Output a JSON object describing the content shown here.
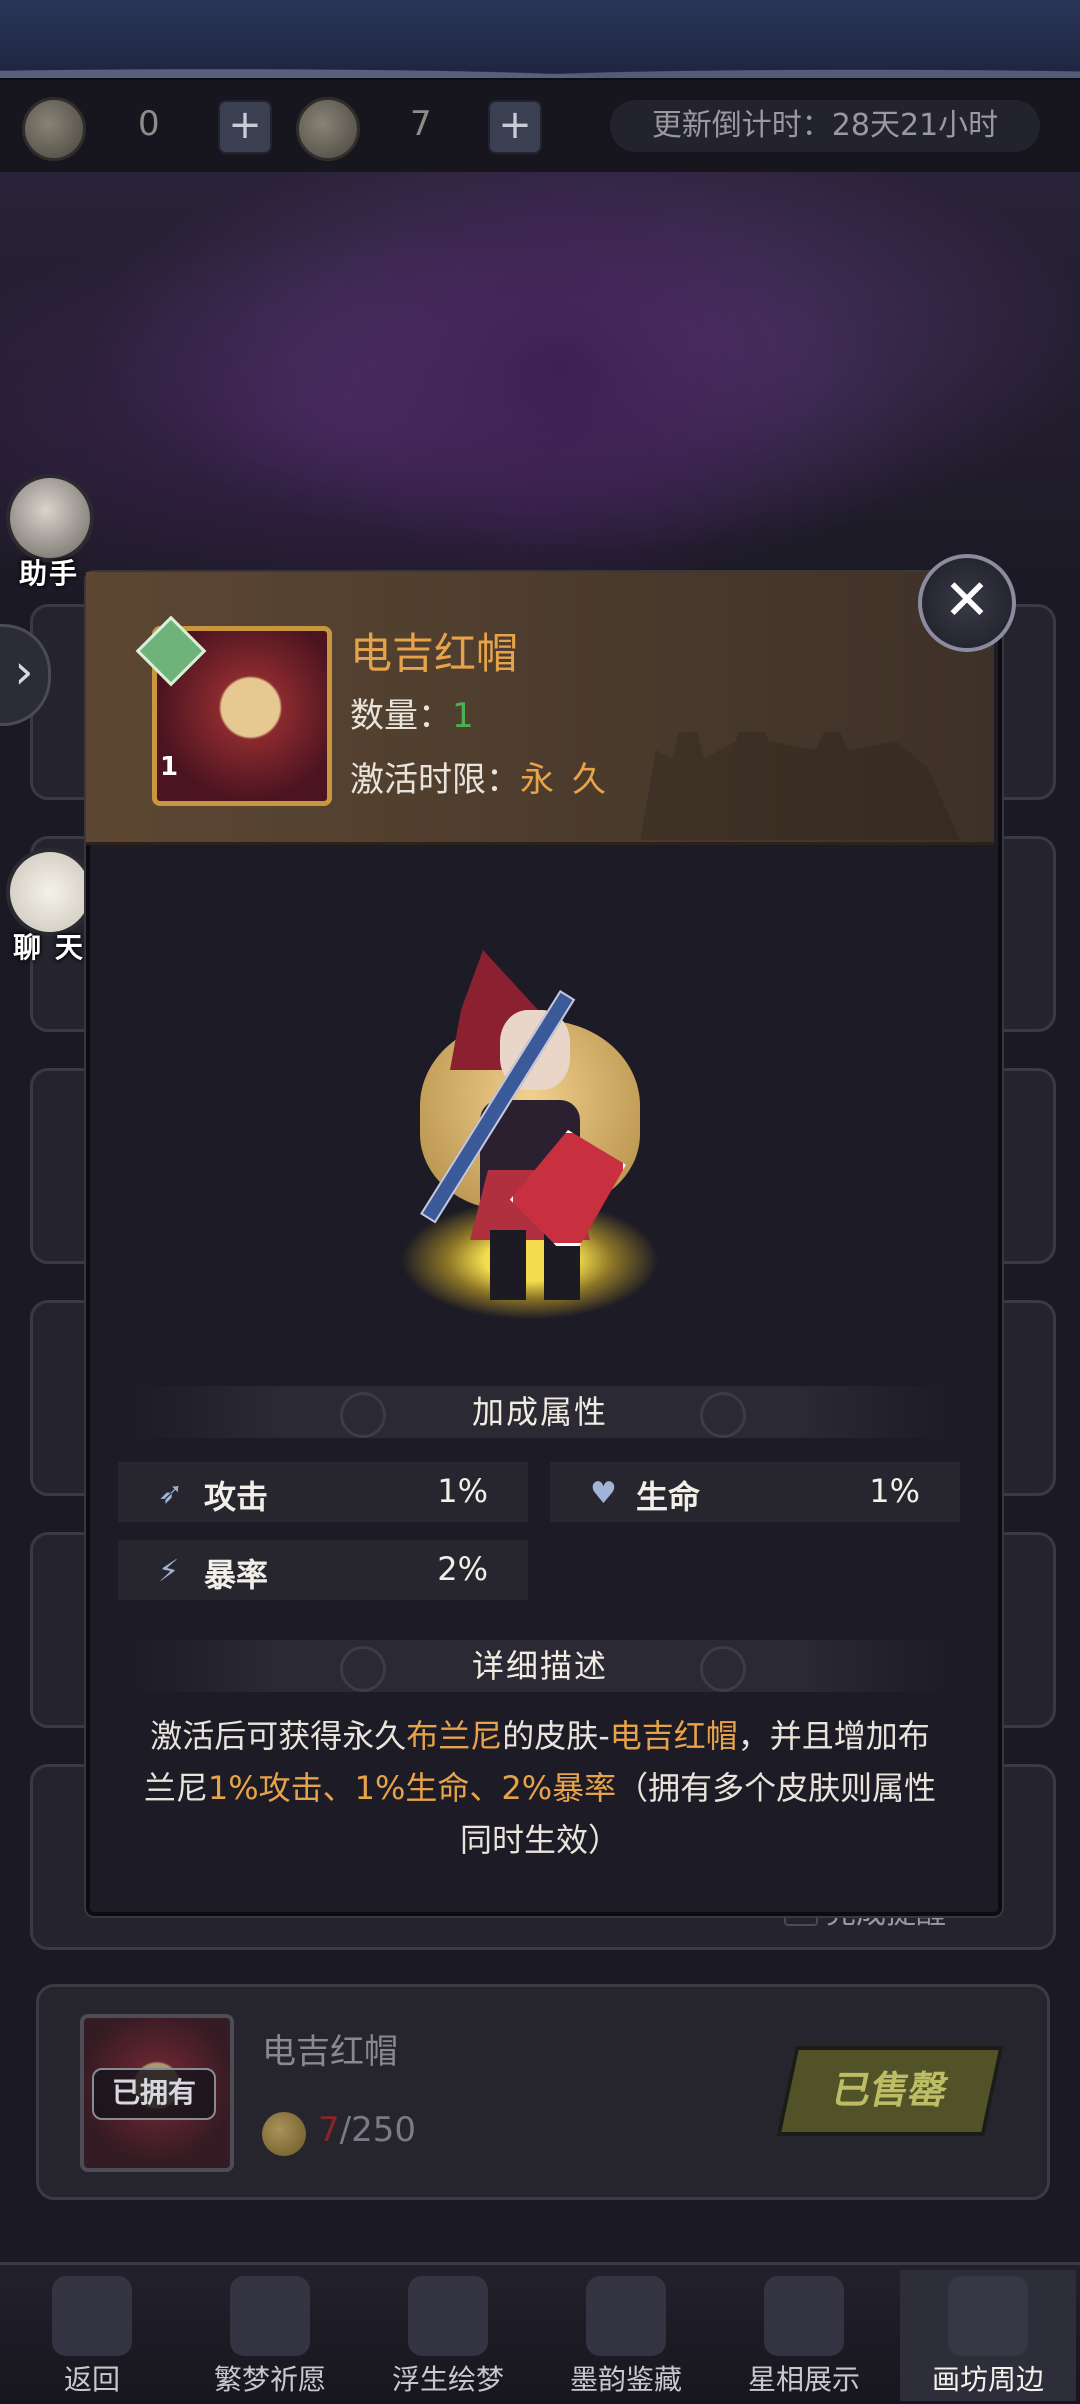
{
  "resources": [
    {
      "icon": "coin-icon",
      "value": "0"
    },
    {
      "icon": "gold-coin-icon",
      "value": "7"
    }
  ],
  "countdown": "更新倒计时：28天21小时",
  "help_label": "?",
  "side": {
    "assistant_label": "助手",
    "chat_label": "聊 天",
    "expand_icon": "›"
  },
  "modal": {
    "skin_name": "电吉红帽",
    "quantity_label": "数量：",
    "quantity_value": "1",
    "limit_label": "激活时限：",
    "limit_value": "永久",
    "portrait_count": "1",
    "close_icon": "✕",
    "bonus_title": "加成属性",
    "stats": [
      {
        "icon": "attack-icon",
        "label": "攻击",
        "value": "1%"
      },
      {
        "icon": "heart-icon",
        "label": "生命",
        "value": "1%"
      },
      {
        "icon": "crit-icon",
        "label": "暴率",
        "value": "2%"
      }
    ],
    "detail_title": "详细描述",
    "desc": {
      "p1": "激活后可获得永久",
      "h1": "布兰尼",
      "p2": "的皮肤-",
      "h2": "电吉红帽",
      "p3": "，并且增加布兰尼",
      "h3": "1%攻击、1%生命、2%暴率",
      "p4": "（拥有多个皮肤则属性同时生效）"
    }
  },
  "background_edges": [
    "9)",
    "0)",
    "0)",
    "9)",
    "0)"
  ],
  "remind_label": "完成提醒",
  "shop_item": {
    "name": "电吉红帽",
    "owned_tag": "已拥有",
    "price_owned": "7",
    "price_total": "/250",
    "sold_label": "已售罄"
  },
  "nav": [
    {
      "icon": "return-icon",
      "label": "返回"
    },
    {
      "icon": "crane-icon",
      "label": "繁梦祈愿"
    },
    {
      "icon": "dream-icon",
      "label": "浮生绘梦"
    },
    {
      "icon": "ink-icon",
      "label": "墨韵鉴藏"
    },
    {
      "icon": "star-icon",
      "label": "星相展示"
    },
    {
      "icon": "scroll-icon",
      "label": "画坊周边"
    }
  ]
}
